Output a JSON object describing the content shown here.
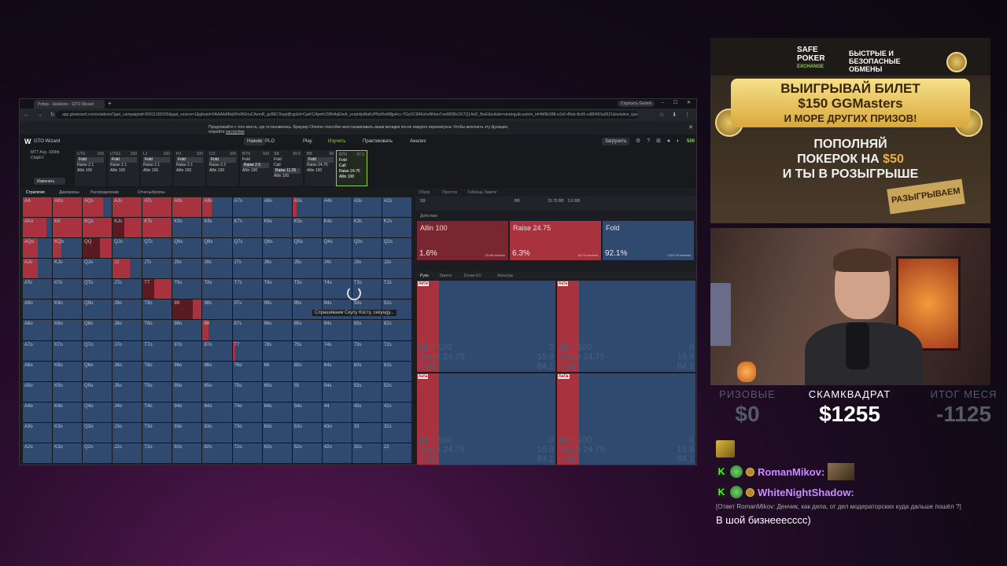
{
  "browser": {
    "tab_title": "Pctlop · Solutions · GTO Wizard",
    "new_tab": "+",
    "gemini": "Спросить Gemini",
    "url": "app.gtowizard.com/solutions?gad_campaignid=20911300155&gad_source=1&gbraid=0AAAAABxj6KnMGnuCAemR_gcBEC9xpjdjfcgclid=CjwKCApefx158hAqEiwA_yorphlipMaKzPNzt5w6Bjp4cu-YGzOC84EsheBhkm7zw985BsCK7Q1AvD_BwE&soltab=strategy&custom_id=fbf9b288-e2c6-45eb-8cb5-cd80453a0521&solution_type=gwiz&gmfs_solutions_t..",
    "info_message": "Продолжайте с того места, где остановились. Браузер Chrome способен восстанавливать ваши вкладки после каждого перезапуска. Чтобы включить эту функцию, откройте",
    "info_link": "настройки"
  },
  "app": {
    "name": "GTO Wizard",
    "mode_active": "Нажим",
    "mode_other": "PLO",
    "nav": [
      "Play",
      "Изучить",
      "Практиковать",
      "Анализ"
    ],
    "upload": "Загрузить",
    "balance": "500"
  },
  "sidebar": {
    "line1": "MTT Avg. 100bb",
    "line2": "ChipEV",
    "change_button": "Изменить"
  },
  "positions": [
    {
      "name": "UTG",
      "stack": "100",
      "actions": [
        "Fold",
        "Raise 2.1",
        "Allin 100"
      ],
      "sel": 0
    },
    {
      "name": "UTG1",
      "stack": "100",
      "actions": [
        "Fold",
        "Raise 2.1",
        "Allin 100"
      ],
      "sel": 0
    },
    {
      "name": "LJ",
      "stack": "100",
      "actions": [
        "Fold",
        "Raise 2.1",
        "Allin 100"
      ],
      "sel": 0
    },
    {
      "name": "HJ",
      "stack": "100",
      "actions": [
        "Fold",
        "Raise 2.1",
        "Allin 100"
      ],
      "sel": 0
    },
    {
      "name": "CO",
      "stack": "100",
      "actions": [
        "Fold",
        "Raise 2.2",
        "Allin 100"
      ],
      "sel": 0
    },
    {
      "name": "BTN",
      "stack": "100",
      "actions": [
        "Fold",
        "Raise 2.5",
        "Allin 100"
      ],
      "sel": 1
    },
    {
      "name": "SB",
      "stack": "99.5",
      "actions": [
        "Fold",
        "Call",
        "Raise 11.25",
        "Allin 100"
      ],
      "sel": 2
    },
    {
      "name": "BB",
      "stack": "99",
      "actions": [
        "Fold",
        "Raise 24.75",
        "Allin 100"
      ],
      "sel": 0
    },
    {
      "name": "BTN",
      "stack": "97.5",
      "actions": [
        "Fold",
        "Call",
        "Raise 24.75",
        "Allin 100"
      ],
      "sel": -1
    }
  ],
  "strategy_tabs": [
    "Стратегия",
    "Диапазоны",
    "Распределение",
    "Отчеты/флопы"
  ],
  "grid": {
    "hands": [
      [
        "AA",
        "AKs",
        "AQs",
        "AJs",
        "ATs",
        "A9s",
        "A8s",
        "A7s",
        "A6s",
        "A5s",
        "A4s",
        "A3s",
        "A2s"
      ],
      [
        "AKo",
        "KK",
        "KQs",
        "KJs",
        "KTs",
        "K9s",
        "K8s",
        "K7s",
        "K6s",
        "K5s",
        "K4s",
        "K3s",
        "K2s"
      ],
      [
        "AQo",
        "KQo",
        "QQ",
        "QJs",
        "QTs",
        "Q9s",
        "Q8s",
        "Q7s",
        "Q6s",
        "Q5s",
        "Q4s",
        "Q3s",
        "Q2s"
      ],
      [
        "AJo",
        "KJo",
        "QJo",
        "JJ",
        "JTs",
        "J9s",
        "J8s",
        "J7s",
        "J6s",
        "J5s",
        "J4s",
        "J3s",
        "J2s"
      ],
      [
        "ATo",
        "KTo",
        "QTo",
        "JTo",
        "TT",
        "T9s",
        "T8s",
        "T7s",
        "T6s",
        "T5s",
        "T4s",
        "T3s",
        "T2s"
      ],
      [
        "A9o",
        "K9o",
        "Q9o",
        "J9o",
        "T9o",
        "99",
        "98s",
        "97s",
        "96s",
        "95s",
        "94s",
        "93s",
        "92s"
      ],
      [
        "A8o",
        "K8o",
        "Q8o",
        "J8o",
        "T8o",
        "98o",
        "88",
        "87s",
        "86s",
        "85s",
        "84s",
        "83s",
        "82s"
      ],
      [
        "A7o",
        "K7o",
        "Q7o",
        "J7o",
        "T7o",
        "97o",
        "87o",
        "77",
        "76s",
        "75s",
        "74s",
        "73s",
        "72s"
      ],
      [
        "A6o",
        "K6o",
        "Q6o",
        "J6o",
        "T6o",
        "96o",
        "86o",
        "76o",
        "66",
        "65s",
        "64s",
        "63s",
        "62s"
      ],
      [
        "A5o",
        "K5o",
        "Q5o",
        "J5o",
        "T5o",
        "95o",
        "85o",
        "75o",
        "65o",
        "55",
        "54s",
        "53s",
        "52s"
      ],
      [
        "A4o",
        "K4o",
        "Q4o",
        "J4o",
        "T4o",
        "94o",
        "84o",
        "74o",
        "64o",
        "54o",
        "44",
        "43s",
        "42s"
      ],
      [
        "A3o",
        "K3o",
        "Q3o",
        "J3o",
        "T3o",
        "93o",
        "83o",
        "73o",
        "63o",
        "53o",
        "43o",
        "33",
        "32s"
      ],
      [
        "A2o",
        "K2o",
        "Q2o",
        "J2o",
        "T2o",
        "92o",
        "82o",
        "72o",
        "62o",
        "52o",
        "42o",
        "32o",
        "22"
      ]
    ],
    "raise_share": [
      [
        1,
        1,
        0.7,
        1,
        1,
        1,
        0.3,
        0,
        0,
        0.15,
        0,
        0,
        0
      ],
      [
        0.8,
        1,
        1,
        0.7,
        1,
        0,
        0,
        0,
        0,
        0,
        0,
        0,
        0
      ],
      [
        0.5,
        0.3,
        1,
        0,
        0,
        0,
        0,
        0,
        0,
        0,
        0,
        0,
        0
      ],
      [
        0.5,
        0,
        0,
        0.6,
        0,
        0,
        0,
        0,
        0,
        0,
        0,
        0,
        0
      ],
      [
        0,
        0,
        0,
        0,
        1,
        0,
        0,
        0,
        0,
        0,
        0,
        0,
        0
      ],
      [
        0,
        0,
        0,
        0,
        0,
        0.3,
        0,
        0,
        0,
        0,
        0,
        0,
        0
      ],
      [
        0,
        0,
        0,
        0,
        0,
        0,
        0.2,
        0,
        0,
        0,
        0,
        0,
        0
      ],
      [
        0,
        0,
        0,
        0,
        0,
        0,
        0,
        0.1,
        0,
        0,
        0,
        0,
        0
      ],
      [
        0,
        0,
        0,
        0,
        0,
        0,
        0,
        0,
        0,
        0,
        0,
        0,
        0
      ],
      [
        0,
        0,
        0,
        0,
        0,
        0,
        0,
        0,
        0,
        0,
        0,
        0,
        0
      ],
      [
        0,
        0,
        0,
        0,
        0,
        0,
        0,
        0,
        0,
        0,
        0,
        0,
        0
      ],
      [
        0,
        0,
        0,
        0,
        0,
        0,
        0,
        0,
        0,
        0,
        0,
        0,
        0
      ],
      [
        0,
        0,
        0,
        0,
        0,
        0,
        0,
        0,
        0,
        0,
        0,
        0,
        0
      ]
    ],
    "allin_share": [
      [
        0,
        0,
        0,
        0,
        0,
        0,
        0,
        0,
        0,
        0,
        0,
        0,
        0
      ],
      [
        0,
        0,
        0,
        0.4,
        0,
        0,
        0,
        0,
        0,
        0,
        0,
        0,
        0
      ],
      [
        0,
        0,
        0.6,
        0,
        0,
        0,
        0,
        0,
        0,
        0,
        0,
        0,
        0
      ],
      [
        0,
        0,
        0,
        0,
        0,
        0,
        0,
        0,
        0,
        0,
        0,
        0,
        0
      ],
      [
        0,
        0,
        0,
        0,
        0.4,
        0,
        0,
        0,
        0,
        0,
        0,
        0,
        0
      ],
      [
        0,
        0,
        0,
        0,
        0,
        0.7,
        0,
        0,
        0,
        0,
        0,
        0,
        0
      ],
      [
        0,
        0,
        0,
        0,
        0,
        0,
        0,
        0,
        0,
        0,
        0,
        0,
        0
      ],
      [
        0,
        0,
        0,
        0,
        0,
        0,
        0,
        0,
        0,
        0,
        0,
        0,
        0
      ],
      [
        0,
        0,
        0,
        0,
        0,
        0,
        0,
        0,
        0,
        0,
        0,
        0,
        0
      ],
      [
        0,
        0,
        0,
        0,
        0,
        0,
        0,
        0,
        0,
        0,
        0,
        0,
        0
      ],
      [
        0,
        0,
        0,
        0,
        0,
        0,
        0,
        0,
        0,
        0,
        0,
        0,
        0
      ],
      [
        0,
        0,
        0,
        0,
        0,
        0,
        0,
        0,
        0,
        0,
        0,
        0,
        0
      ],
      [
        0,
        0,
        0,
        0,
        0,
        0,
        0,
        0,
        0,
        0,
        0,
        0,
        0
      ]
    ],
    "loading_text": "Спрашиваем Скулу Косту, секунду..."
  },
  "right_panel": {
    "tabs": [
      "Обзор",
      "Простое",
      "Таблица Эквити"
    ],
    "info": [
      "SB",
      "BB",
      "15.75 BB",
      "2.6 BB"
    ],
    "sub": "Действия",
    "actions": [
      {
        "label": "Allin 100",
        "pct": "1.6%",
        "combos": "20.88 combos"
      },
      {
        "label": "Raise 24.75",
        "pct": "6.3%",
        "combos": "82.04 combos"
      },
      {
        "label": "Fold",
        "pct": "92.1%",
        "combos": "1221.16 combos"
      }
    ],
    "tabs2": [
      "Руки",
      "Эквити",
      "Блоки EV",
      "Фильтры"
    ],
    "combos": [
      {
        "cards": "A♥5♥",
        "lines": [
          [
            "Allin 100",
            "0"
          ],
          [
            "Raise 24.75",
            "15.9"
          ],
          [
            "Fold",
            "84.1"
          ]
        ]
      },
      {
        "cards": "A♦5♦",
        "lines": [
          [
            "Allin 100",
            "0"
          ],
          [
            "Raise 24.75",
            "15.9"
          ],
          [
            "Fold",
            "84.1"
          ]
        ]
      },
      {
        "cards": "A♠5♠",
        "lines": [
          [
            "Allin 100",
            "0"
          ],
          [
            "Raise 24.75",
            "15.9"
          ],
          [
            "Fold",
            "84.1"
          ]
        ]
      },
      {
        "cards": "A♣5♣",
        "lines": [
          [
            "Allin 100",
            "0"
          ],
          [
            "Raise 24.75",
            "15.9"
          ],
          [
            "Fold",
            "84.1"
          ]
        ]
      }
    ]
  },
  "ad": {
    "logo_line1": "SAFE",
    "logo_line2": "POKER",
    "logo_line3": "EXCHANGE",
    "tagline": "БЫСТРЫЕ И БЕЗОПАСНЫЕ ОБМЕНЫ",
    "banner_l1": "ВЫИГРЫВАЙ БИЛЕТ",
    "banner_l2": "$150 GGMasters",
    "banner_l3": "И МОРЕ ДРУГИХ ПРИЗОВ!",
    "promo_l1": "ПОПОЛНЯЙ",
    "promo_l2a": "ПОКЕРОК НА ",
    "promo_l2b": "$50",
    "promo_l3": "И ТЫ В РОЗЫГРЫШЕ",
    "stamp": "РАЗЫГРЫВАЕМ"
  },
  "stats": {
    "left_label": "РИЗОВЫЕ",
    "left_value": "$0",
    "center_label": "СКАМКВАДРАТ",
    "center_value": "$1255",
    "right_label": "ИТОГ МЕСЯ",
    "right_value": "-1125"
  },
  "chat": {
    "m1_user": "RomanMikov:",
    "m2_user": "WhiteNightShadow:",
    "m2_reply": "[Ответ RomanMikov: Денчик, как дела, от дел модераторских куда дальше пошёл ?]",
    "m2_text": "В шой бизнееесссс)"
  }
}
